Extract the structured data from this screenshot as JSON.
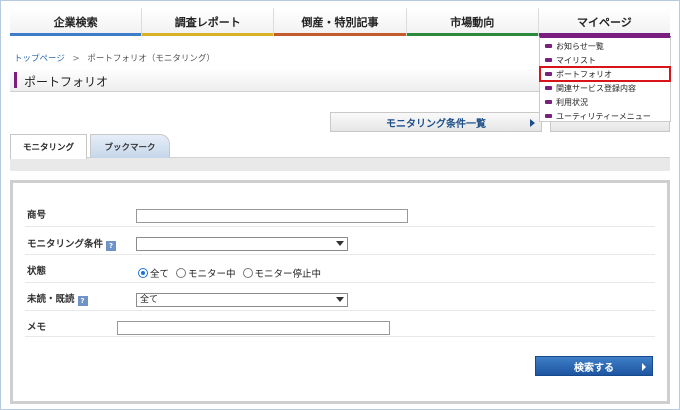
{
  "nav": {
    "items": [
      {
        "label": "企業検索",
        "color": "#3d7dc9"
      },
      {
        "label": "調査レポート",
        "color": "#d9b227"
      },
      {
        "label": "倒産・特別記事",
        "color": "#c55a2d"
      },
      {
        "label": "市場動向",
        "color": "#2a8a3c"
      },
      {
        "label": "マイページ",
        "color": "#7a1e80"
      }
    ]
  },
  "breadcrumb": {
    "home": "トップページ",
    "separator": ">",
    "current": "ポートフォリオ（モニタリング）"
  },
  "page_title": "ポートフォリオ",
  "condition_button": "モニタリング条件一覧",
  "tabs": {
    "monitoring": "モニタリング",
    "bookmark": "ブックマーク"
  },
  "form": {
    "name_label": "商号",
    "name_value": "",
    "condition_label": "モニタリング条件",
    "condition_value": "",
    "status_label": "状態",
    "status_options": [
      "全て",
      "モニター中",
      "モニター停止中"
    ],
    "status_selected": "全て",
    "read_label": "未読・既読",
    "read_value": "全て",
    "memo_label": "メモ",
    "memo_value": "",
    "help_icon": "?",
    "search_button": "検索する"
  },
  "mypage_menu": {
    "items": [
      "お知らせ一覧",
      "マイリスト",
      "ポートフォリオ",
      "関連サービス登録内容",
      "利用状況",
      "ユーティリティーメニュー"
    ],
    "highlighted": "ポートフォリオ"
  },
  "colors": {
    "accent": "#7a1e80",
    "link": "#2a6ab3",
    "primary_button": "#1d55a0",
    "highlight_box": "#d8141b"
  }
}
